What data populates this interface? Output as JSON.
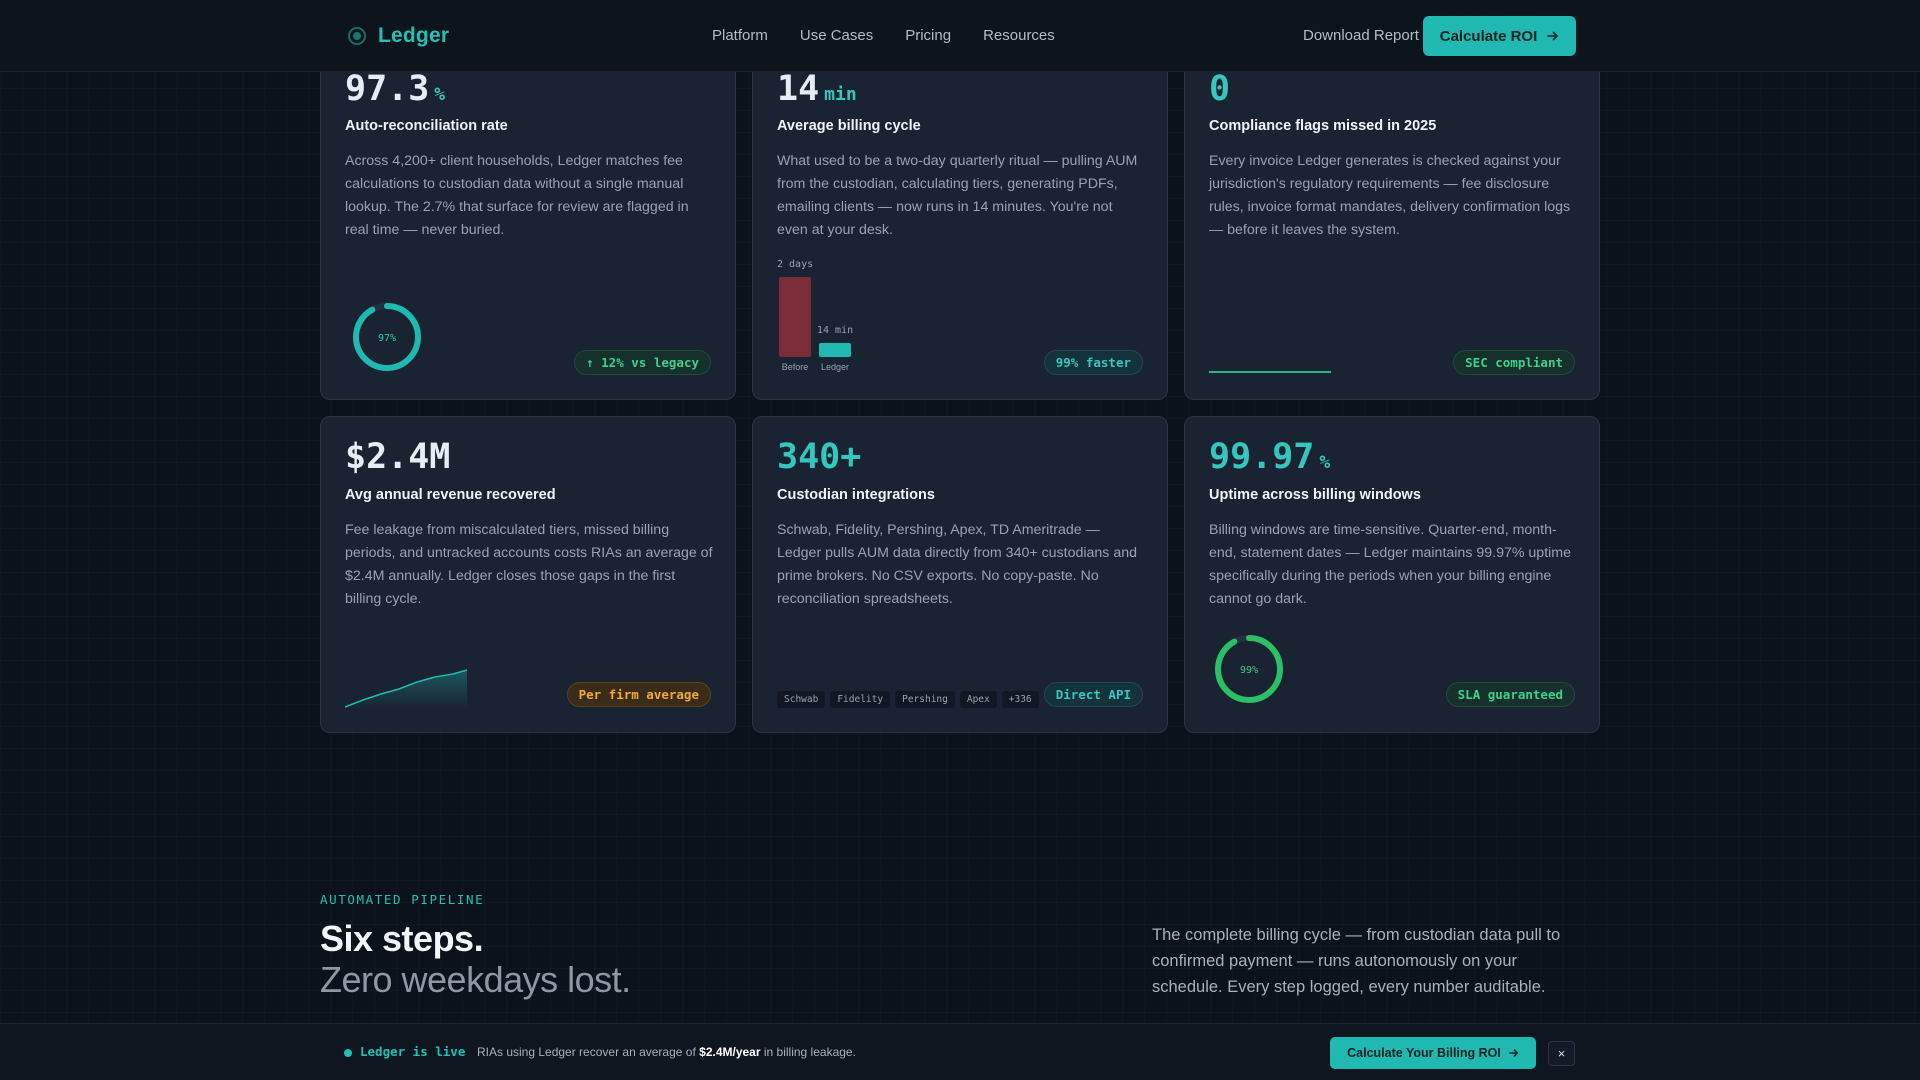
{
  "nav": {
    "brand": "Ledger",
    "links": [
      "Platform",
      "Use Cases",
      "Pricing",
      "Resources"
    ],
    "download": "Download Report",
    "cta": "Calculate ROI",
    "cta_icon": "arrow-right-icon"
  },
  "cards": [
    {
      "metric": "97.3",
      "unit": "%",
      "title": "Auto-reconciliation rate",
      "desc": "Across 4,200+ client households, Ledger matches fee calculations to custodian data without a single manual lookup. The 2.7% that surface for review are flagged in real time — never buried.",
      "badge": "↑ 12% vs legacy",
      "ring_label": "97%",
      "ring_value": 0.973
    },
    {
      "metric": "14",
      "unit": "min",
      "title": "Average billing cycle",
      "desc": "What used to be a two-day quarterly ritual — pulling AUM from the custodian, calculating tiers, generating PDFs, emailing clients — now runs in 14 minutes. You're not even at your desk.",
      "badge": "99% faster",
      "bars": [
        {
          "label": "Before",
          "value_label": "2 days",
          "color": "#7a2d38"
        },
        {
          "label": "Ledger",
          "value_label": "14 min",
          "color": "#1fb9b1"
        }
      ]
    },
    {
      "metric": "0",
      "unit": "",
      "title": "Compliance flags missed in 2025",
      "desc": "Every invoice Ledger generates is checked against your jurisdiction's regulatory requirements — fee disclosure rules, invoice format mandates, delivery confirmation logs — before it leaves the system.",
      "badge": "SEC compliant"
    },
    {
      "metric": "$2.4M",
      "unit": "",
      "title": "Avg annual revenue recovered",
      "desc": "Fee leakage from miscalculated tiers, missed billing periods, and untracked accounts costs RIAs an average of $2.4M annually. Ledger closes those gaps in the first billing cycle.",
      "badge": "Per firm average"
    },
    {
      "metric": "340+",
      "unit": "",
      "title": "Custodian integrations",
      "desc": "Schwab, Fidelity, Pershing, Apex, TD Ameritrade — Ledger pulls AUM data directly from 340+ custodians and prime brokers. No CSV exports. No copy-paste. No reconciliation spreadsheets.",
      "badge": "Direct API",
      "chips": [
        "Schwab",
        "Fidelity",
        "Pershing",
        "Apex",
        "+336"
      ]
    },
    {
      "metric": "99.97",
      "unit": "%",
      "title": "Uptime across billing windows",
      "desc": "Billing windows are time-sensitive. Quarter-end, month-end, statement dates — Ledger maintains 99.97% uptime specifically during the periods when your billing engine cannot go dark.",
      "badge": "SLA guaranteed",
      "ring_label": "99%",
      "ring_value": 0.999
    }
  ],
  "section": {
    "eyebrow": "AUTOMATED PIPELINE",
    "heading1": "Six steps.",
    "heading2": "Zero weekdays lost.",
    "desc": "The complete billing cycle — from custodian data pull to confirmed payment — runs autonomously on your schedule. Every step logged, every number auditable."
  },
  "banner": {
    "live": "Ledger is live",
    "msg_prefix": "RIAs using Ledger recover an average of ",
    "msg_bold": "$2.4M/year",
    "msg_suffix": " in billing leakage.",
    "cta": "Calculate Your Billing ROI",
    "close": "×"
  },
  "colors": {
    "accent": "#1fb9b1",
    "green": "#3fd08d",
    "orange": "#f3a93a",
    "card_bg": "#1a2332",
    "page_bg": "#0c121b"
  }
}
